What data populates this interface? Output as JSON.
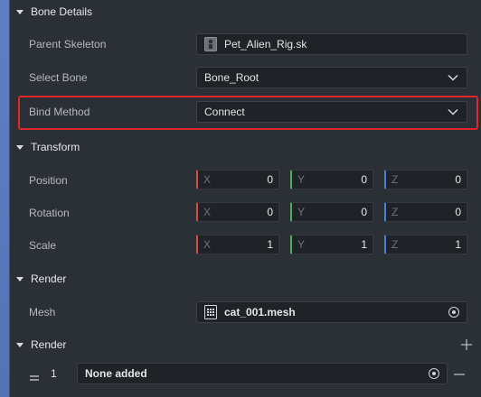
{
  "sections": {
    "bone_details": {
      "title": "Bone Details"
    },
    "transform": {
      "title": "Transform"
    },
    "render": {
      "title": "Render"
    },
    "render_list": {
      "title": "Render"
    }
  },
  "bone_details": {
    "parent_skeleton": {
      "label": "Parent Skeleton",
      "value": "Pet_Alien_Rig.sk"
    },
    "select_bone": {
      "label": "Select Bone",
      "value": "Bone_Root"
    },
    "bind_method": {
      "label": "Bind Method",
      "value": "Connect"
    }
  },
  "transform": {
    "position": {
      "label": "Position",
      "x": "0",
      "y": "0",
      "z": "0"
    },
    "rotation": {
      "label": "Rotation",
      "x": "0",
      "y": "0",
      "z": "0"
    },
    "scale": {
      "label": "Scale",
      "x": "1",
      "y": "1",
      "z": "1"
    },
    "axes": {
      "x": "X",
      "y": "Y",
      "z": "Z"
    }
  },
  "render": {
    "mesh": {
      "label": "Mesh",
      "value": "cat_001.mesh"
    }
  },
  "render_list": {
    "index": "1",
    "value": "None added"
  },
  "colors": {
    "highlight": "#e0262b",
    "axis_x": "#d14b4b",
    "axis_y": "#4fae5a",
    "axis_z": "#4a7fd1"
  }
}
